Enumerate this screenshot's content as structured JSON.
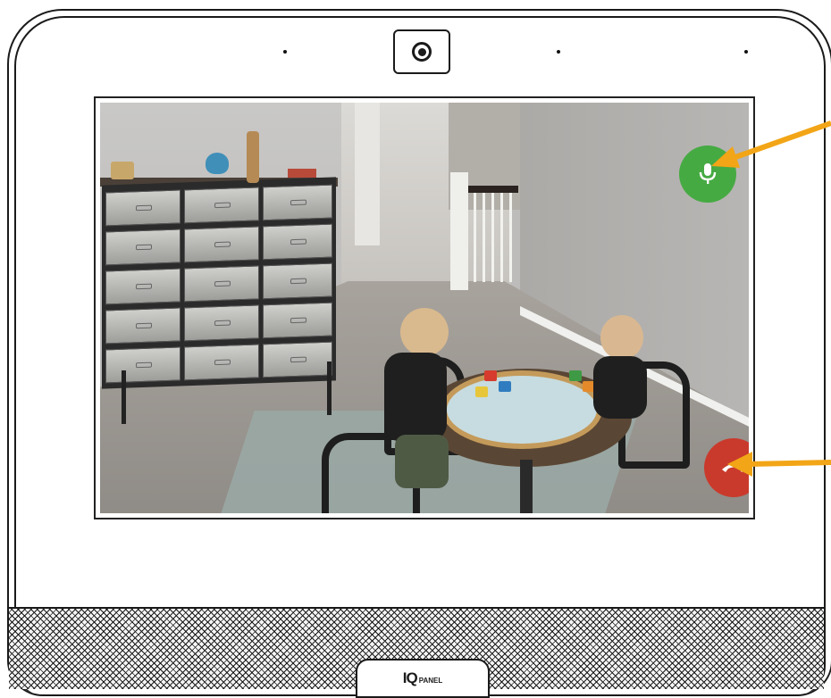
{
  "device": {
    "brand": {
      "logo_mark": "IQ",
      "logo_text": "PANEL"
    },
    "camera_icon": "camera-lens-icon"
  },
  "video_call": {
    "feed": "live-camera-feed",
    "controls": {
      "mic_button_icon": "microphone-icon",
      "mic_button_color": "#46aa43",
      "hangup_button_icon": "phone-hangup-icon",
      "hangup_button_color": "#c93a2c"
    }
  },
  "annotations": {
    "arrow_color": "#f2a516",
    "arrow_icons": [
      "arrow-to-mic-icon",
      "arrow-to-hangup-icon"
    ]
  }
}
